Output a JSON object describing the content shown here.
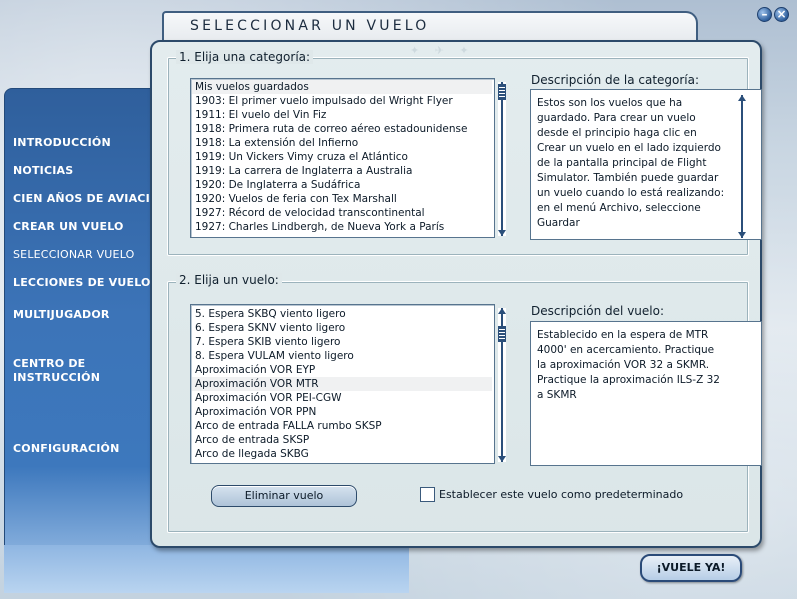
{
  "window": {
    "title": "SELECCIONAR UN VUELO",
    "minimize_icon": "minimize-icon",
    "close_icon": "close-icon"
  },
  "sidebar": {
    "items": [
      {
        "label": "INTRODUCCIÓN"
      },
      {
        "label": "NOTICIAS"
      },
      {
        "label": "CIEN AÑOS DE AVIACIÓN"
      },
      {
        "label": "CREAR UN VUELO"
      },
      {
        "label": "SELECCIONAR VUELO"
      },
      {
        "label": "LECCIONES DE VUELO"
      },
      {
        "label": "MULTIJUGADOR"
      },
      {
        "label": "CENTRO DE"
      },
      {
        "label": "INSTRUCCIÓN"
      },
      {
        "label": "CONFIGURACIÓN"
      }
    ]
  },
  "category": {
    "group_label": "1. Elija una categoría:",
    "items": [
      "Mis vuelos guardados",
      "1903: El primer vuelo impulsado del Wright Flyer",
      "1911: El vuelo del Vin Fiz",
      "1918: Primera ruta de correo aéreo estadounidense",
      "1918: La extensión del Infierno",
      "1919: Un Vickers Vimy cruza el Atlántico",
      "1919: La carrera de Inglaterra a Australia",
      "1920: De Inglaterra a Sudáfrica",
      "1920: Vuelos de feria con Tex Marshall",
      "1927: Récord de velocidad transcontinental",
      "1927: Charles Lindbergh, de Nueva York a París"
    ],
    "selected_index": 0,
    "description_heading": "Descripción de la categoría:",
    "description": "Estos son los vuelos que ha guardado. Para crear un vuelo desde el principio haga clic en Crear un vuelo en el lado izquierdo de la pantalla principal de Flight Simulator. También puede guardar un vuelo cuando lo está realizando: en el menú Archivo, seleccione Guardar"
  },
  "flight": {
    "group_label": "2. Elija un vuelo:",
    "items": [
      "5. Espera SKBQ viento ligero",
      "6. Espera SKNV viento ligero",
      "7. Espera SKIB viento ligero",
      "8. Espera VULAM viento ligero",
      "Aproximación VOR EYP",
      "Aproximación VOR MTR",
      "Aproximación VOR PEI-CGW",
      "Aproximación VOR PPN",
      "Arco de entrada FALLA  rumbo SKSP",
      "Arco de entrada SKSP",
      "Arco de llegada SKBG"
    ],
    "selected_index": 5,
    "description_heading": "Descripción del vuelo:",
    "description": "Establecido en la espera de MTR 4000' en acercamiento.  Practique la aproximación VOR 32 a SKMR. Practique la aproximación ILS-Z 32 a SKMR"
  },
  "actions": {
    "delete_label": "Eliminar vuelo",
    "default_checkbox_label": "Establecer este vuelo como predeterminado",
    "default_checked": false,
    "fly_label": "¡VUELE YA!"
  }
}
